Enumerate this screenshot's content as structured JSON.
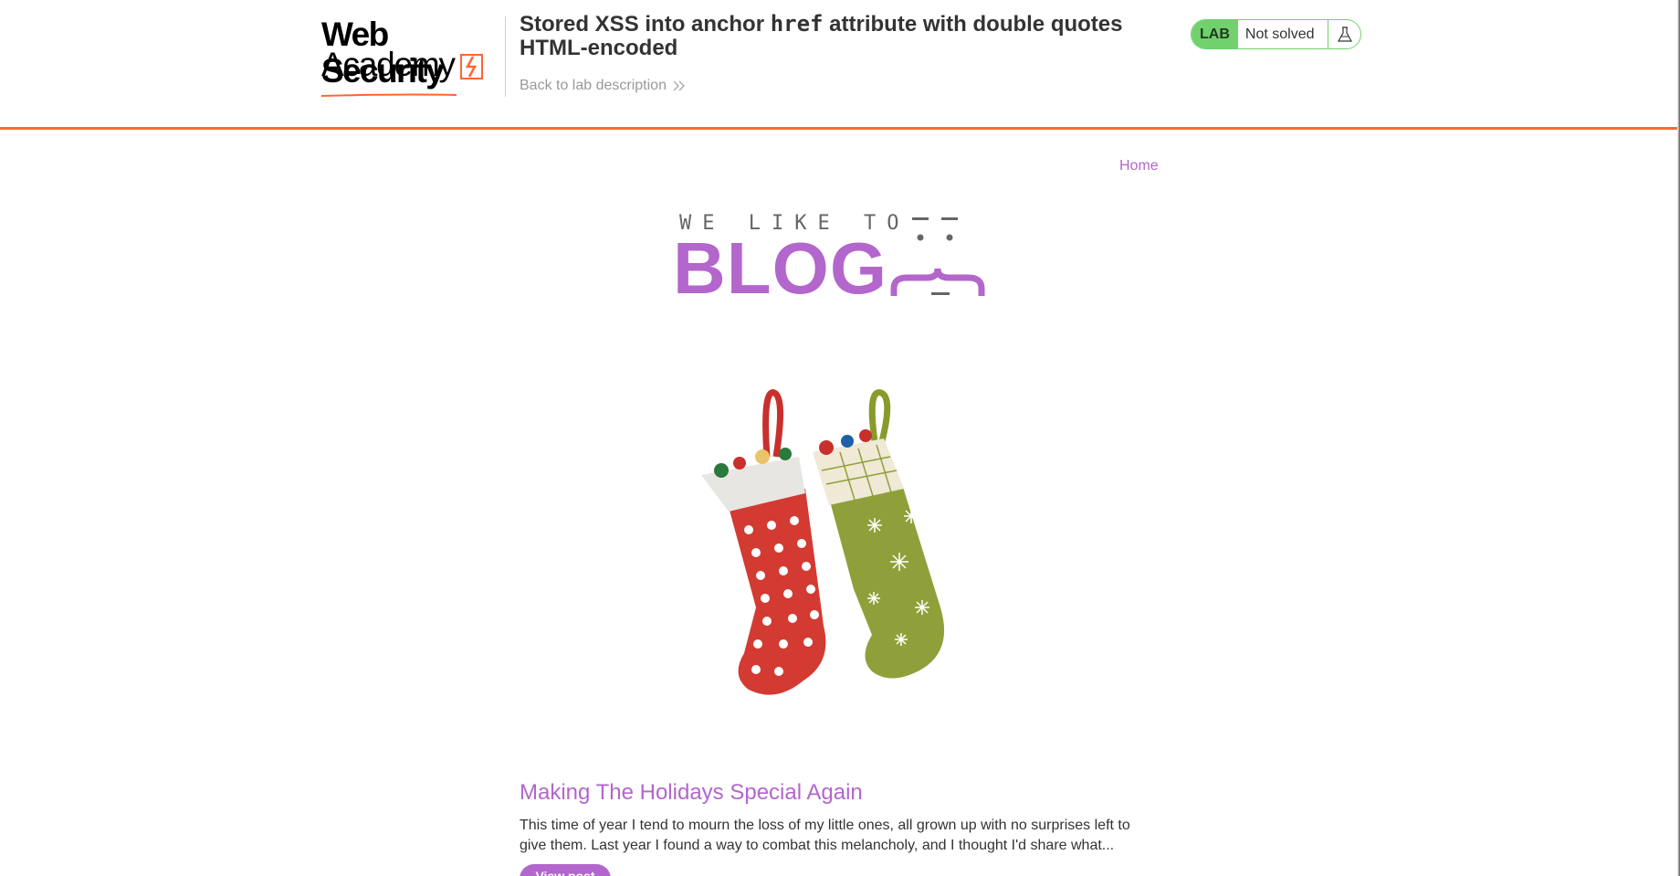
{
  "academy": {
    "logo_line1": "Web Security",
    "logo_line2": "Academy",
    "lab_title_before": "Stored XSS into anchor ",
    "lab_title_code": "href",
    "lab_title_after": " attribute with double quotes HTML-encoded",
    "back_link": "Back to lab description",
    "status_tag": "LAB",
    "status_text": "Not solved",
    "icons": {
      "back": "double-chevron-right-icon",
      "status": "flask-icon"
    },
    "colors": {
      "accent": "#ff6633",
      "status": "#70d16d"
    }
  },
  "blog": {
    "nav": {
      "home": "Home"
    },
    "banner": {
      "tagline": "WE LIKE TO",
      "word": "BLOG"
    },
    "hero_image": "christmas-stockings-image",
    "colors": {
      "primary": "#b366cc"
    },
    "posts": [
      {
        "title": "Making The Holidays Special Again",
        "summary": "This time of year I tend to mourn the loss of my little ones, all grown up with no surprises left to give them. Last year I found a way to combat this melancholy, and I thought I'd share what...",
        "button": "View post"
      }
    ]
  }
}
